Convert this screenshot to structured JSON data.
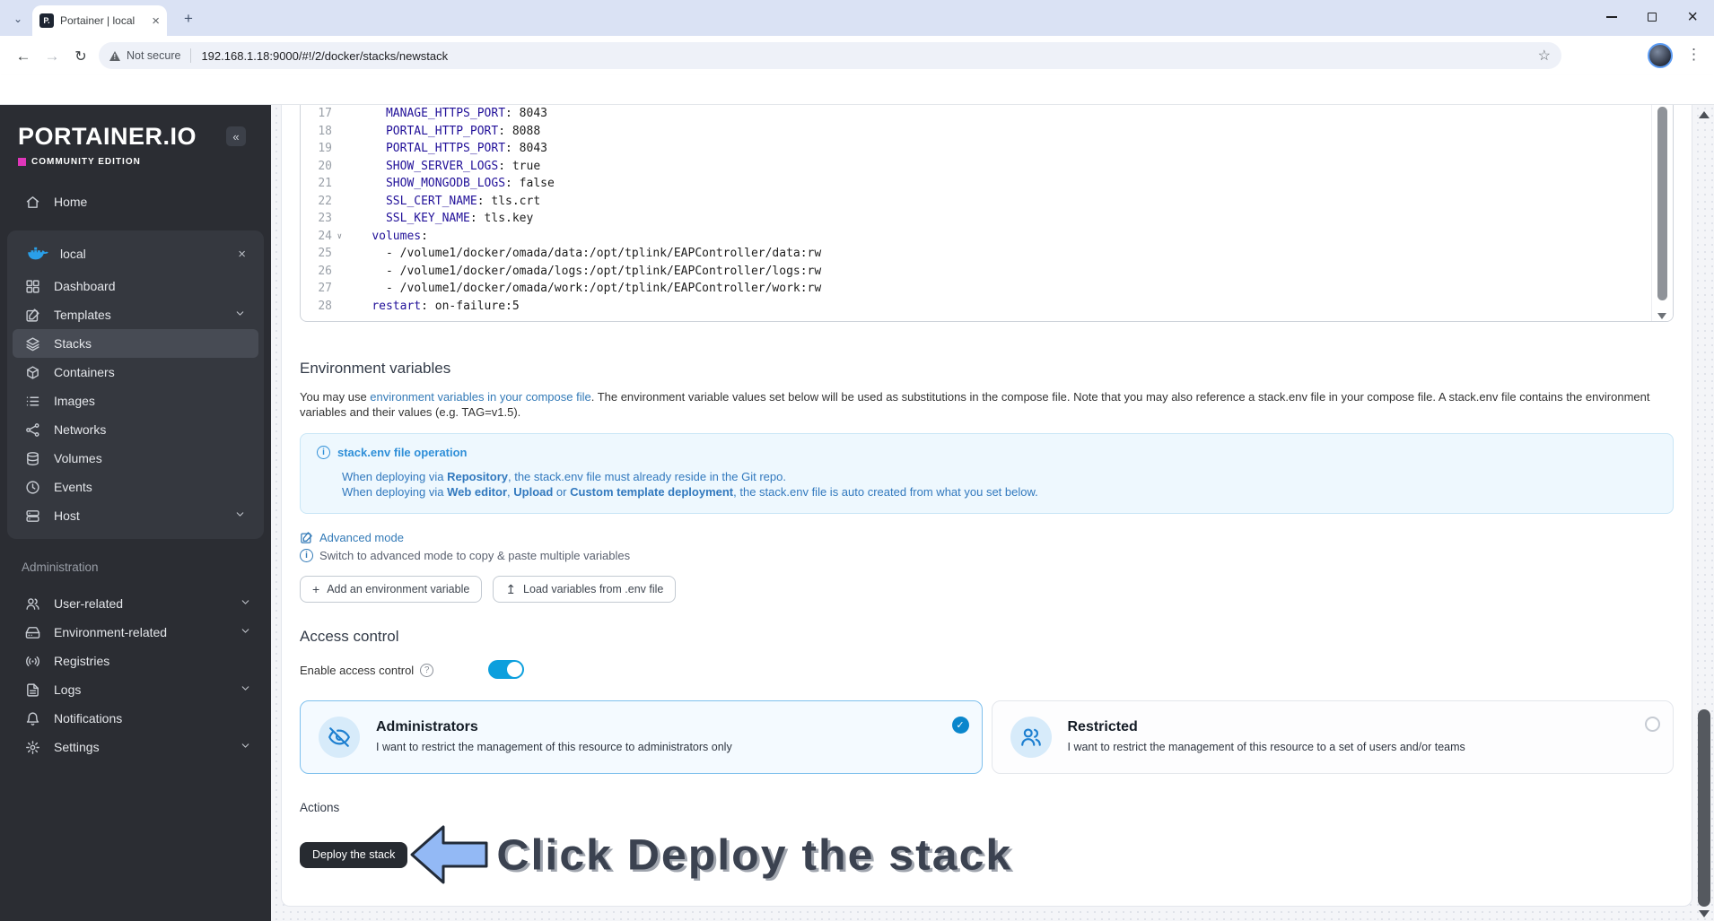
{
  "browser": {
    "tab_title": "Portainer | local",
    "favicon_text": "P.",
    "security_label": "Not secure",
    "url": "192.168.1.18:9000/#!/2/docker/stacks/newstack"
  },
  "sidebar": {
    "logo": "PORTAINER.IO",
    "edition": "COMMUNITY EDITION",
    "collapse_glyph": "«",
    "home_label": "Home",
    "environment_name": "local",
    "env_items": [
      {
        "label": "Dashboard",
        "icon": "dashboard"
      },
      {
        "label": "Templates",
        "icon": "templates",
        "expandable": true
      },
      {
        "label": "Stacks",
        "icon": "stacks",
        "selected": true
      },
      {
        "label": "Containers",
        "icon": "containers"
      },
      {
        "label": "Images",
        "icon": "images"
      },
      {
        "label": "Networks",
        "icon": "networks"
      },
      {
        "label": "Volumes",
        "icon": "volumes"
      },
      {
        "label": "Events",
        "icon": "events"
      },
      {
        "label": "Host",
        "icon": "host",
        "expandable": true
      }
    ],
    "admin_label": "Administration",
    "admin_items": [
      {
        "label": "User-related",
        "icon": "users",
        "expandable": true
      },
      {
        "label": "Environment-related",
        "icon": "harddrive",
        "expandable": true
      },
      {
        "label": "Registries",
        "icon": "radio"
      },
      {
        "label": "Logs",
        "icon": "filetext",
        "expandable": true
      },
      {
        "label": "Notifications",
        "icon": "bell"
      },
      {
        "label": "Settings",
        "icon": "gear",
        "expandable": true
      }
    ]
  },
  "editor": {
    "lines": [
      {
        "n": 17,
        "ind": 6,
        "k": "MANAGE_HTTPS_PORT",
        "v": "8043"
      },
      {
        "n": 18,
        "ind": 6,
        "k": "PORTAL_HTTP_PORT",
        "v": "8088"
      },
      {
        "n": 19,
        "ind": 6,
        "k": "PORTAL_HTTPS_PORT",
        "v": "8043"
      },
      {
        "n": 20,
        "ind": 6,
        "k": "SHOW_SERVER_LOGS",
        "v": "true"
      },
      {
        "n": 21,
        "ind": 6,
        "k": "SHOW_MONGODB_LOGS",
        "v": "false"
      },
      {
        "n": 22,
        "ind": 6,
        "k": "SSL_CERT_NAME",
        "v": "tls.crt"
      },
      {
        "n": 23,
        "ind": 6,
        "k": "SSL_KEY_NAME",
        "v": "tls.key"
      },
      {
        "n": 24,
        "ind": 4,
        "k": "volumes",
        "v": "",
        "fold": true
      },
      {
        "n": 25,
        "ind": 6,
        "t": "- /volume1/docker/omada/data:/opt/tplink/EAPController/data:rw"
      },
      {
        "n": 26,
        "ind": 6,
        "t": "- /volume1/docker/omada/logs:/opt/tplink/EAPController/logs:rw"
      },
      {
        "n": 27,
        "ind": 6,
        "t": "- /volume1/docker/omada/work:/opt/tplink/EAPController/work:rw"
      },
      {
        "n": 28,
        "ind": 4,
        "k": "restart",
        "v": "on-failure:5"
      }
    ]
  },
  "env_section": {
    "heading": "Environment variables",
    "intro_t1": "You may use ",
    "intro_link": "environment variables in your compose file",
    "intro_t2": ". The environment variable values set below will be used as substitutions in the compose file. Note that you may also reference a stack.env file in your compose file. A stack.env file contains the environment variables and their values (e.g. TAG=v1.5).",
    "tip_title": "stack.env file operation",
    "tip_l1_t1": "When deploying via ",
    "tip_l1_b1": "Repository",
    "tip_l1_t2": ", the stack.env file must already reside in the Git repo.",
    "tip_l2_t1": "When deploying via ",
    "tip_l2_b1": "Web editor",
    "tip_l2_t2": ", ",
    "tip_l2_b2": "Upload",
    "tip_l2_t3": " or ",
    "tip_l2_b3": "Custom template deployment",
    "tip_l2_t4": ", the stack.env file is auto created from what you set below.",
    "advanced_label": "Advanced mode",
    "advanced_note": "Switch to advanced mode to copy & paste multiple variables",
    "add_button": "Add an environment variable",
    "load_button": "Load variables from .env file"
  },
  "access_control": {
    "heading": "Access control",
    "enable_label": "Enable access control",
    "options": [
      {
        "title": "Administrators",
        "desc": "I want to restrict the management of this resource to administrators only",
        "icon": "eyeoff",
        "selected": true
      },
      {
        "title": "Restricted",
        "desc": "I want to restrict the management of this resource to a set of users and/or teams",
        "icon": "users",
        "selected": false
      }
    ]
  },
  "actions": {
    "heading": "Actions",
    "deploy_label": "Deploy the stack",
    "annotation": "Click Deploy the stack"
  },
  "colors": {
    "toggle_on": "#0c9fdd",
    "tip_blue": "#337ab7",
    "selected_card_border": "#7fc0ed",
    "check_badge": "#0a86cc",
    "deploy_bg": "#272b31",
    "arrow_fill": "#93b9f5",
    "edition_pink": "#df36b9",
    "yaml_key": "#221199"
  }
}
